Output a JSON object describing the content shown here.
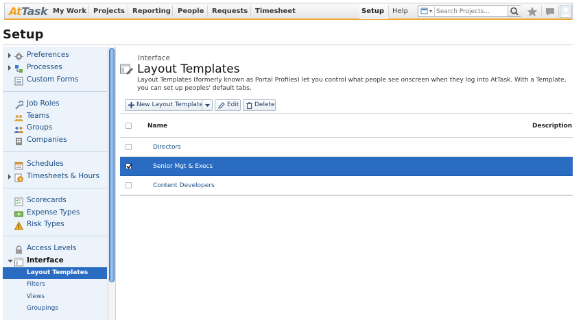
{
  "topbar": {
    "logo_part1": "At",
    "logo_part2": "Task",
    "nav": [
      "My Work",
      "Projects",
      "Reporting",
      "People",
      "Requests",
      "Timesheet"
    ],
    "setup": "Setup",
    "help": "Help",
    "search_placeholder": "Search Projects...",
    "accent_color": "#f0a830"
  },
  "page": {
    "title": "Setup"
  },
  "sidebar": {
    "groups": [
      {
        "items": [
          {
            "label": "Preferences",
            "icon": "gear-icon",
            "expandable": true
          },
          {
            "label": "Processes",
            "icon": "processes-icon",
            "expandable": true
          },
          {
            "label": "Custom Forms",
            "icon": "form-icon",
            "expandable": false
          }
        ]
      },
      {
        "items": [
          {
            "label": "Job Roles",
            "icon": "wrench-icon",
            "expandable": false
          },
          {
            "label": "Teams",
            "icon": "team-icon",
            "expandable": false
          },
          {
            "label": "Groups",
            "icon": "group-icon",
            "expandable": false
          },
          {
            "label": "Companies",
            "icon": "building-icon",
            "expandable": false
          }
        ]
      },
      {
        "items": [
          {
            "label": "Schedules",
            "icon": "calendar-icon",
            "expandable": false
          },
          {
            "label": "Timesheets & Hours",
            "icon": "clock-icon",
            "expandable": true
          }
        ]
      },
      {
        "items": [
          {
            "label": "Scorecards",
            "icon": "scorecard-icon",
            "expandable": false
          },
          {
            "label": "Expense Types",
            "icon": "money-icon",
            "expandable": false
          },
          {
            "label": "Risk Types",
            "icon": "warning-icon",
            "expandable": false
          }
        ]
      },
      {
        "items": [
          {
            "label": "Access Levels",
            "icon": "lock-icon",
            "expandable": false
          },
          {
            "label": "Interface",
            "icon": "interface-icon",
            "expanded": true
          }
        ]
      }
    ],
    "interface_children": [
      "Layout Templates",
      "Filters",
      "Views",
      "Groupings"
    ],
    "active_child": "Layout Templates"
  },
  "main": {
    "breadcrumb": "Interface",
    "title": "Layout Templates",
    "description": "Layout Templates (formerly known as Portal Profiles) let you control what people see onscreen when they log into AtTask. With a Template, you can set up peoples' default tabs.",
    "toolbar": {
      "new": "New Layout Template",
      "edit": "Edit",
      "delete": "Delete"
    },
    "table": {
      "columns": [
        "Name",
        "Description"
      ],
      "rows": [
        {
          "name": "Directors",
          "selected": false
        },
        {
          "name": "Senior Mgt & Execs",
          "selected": true
        },
        {
          "name": "Content Developers",
          "selected": false
        }
      ]
    },
    "selection_color": "#2a6cc2"
  }
}
